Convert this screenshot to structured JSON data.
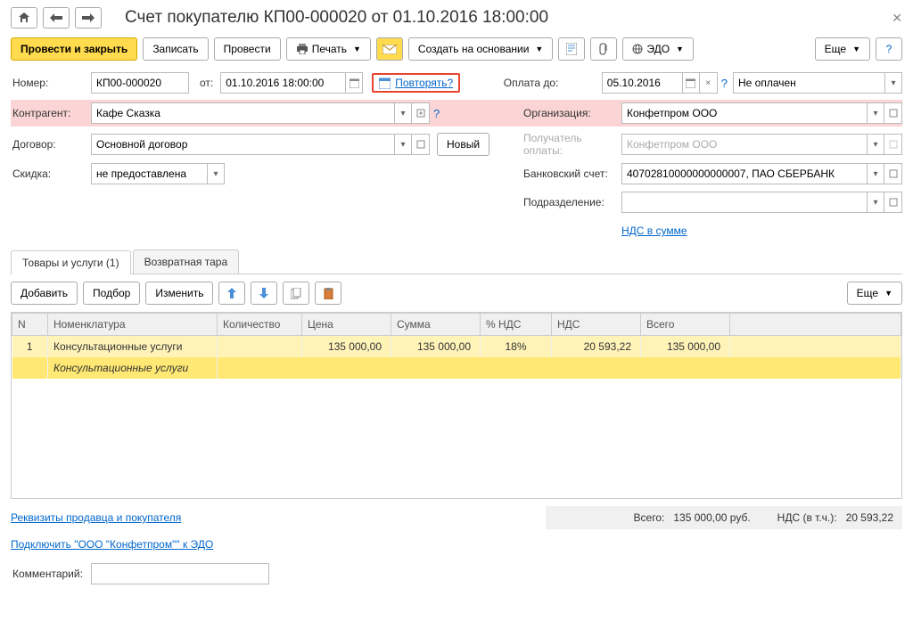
{
  "header": {
    "title": "Счет покупателю КП00-000020 от 01.10.2016 18:00:00"
  },
  "toolbar": {
    "post_close": "Провести и закрыть",
    "write": "Записать",
    "post": "Провести",
    "print": "Печать",
    "create_based": "Создать на основании",
    "edo": "ЭДО",
    "more": "Еще"
  },
  "form": {
    "number_lbl": "Номер:",
    "number": "КП00-000020",
    "from_lbl": "от:",
    "date": "01.10.2016 18:00:00",
    "repeat_link": "Повторять?",
    "payment_due_lbl": "Оплата до:",
    "payment_due": "05.10.2016",
    "status": "Не оплачен",
    "counterparty_lbl": "Контрагент:",
    "counterparty": "Кафе Сказка",
    "organization_lbl": "Организация:",
    "organization": "Конфетпром ООО",
    "contract_lbl": "Договор:",
    "contract": "Основной договор",
    "new_btn": "Новый",
    "payee_lbl": "Получатель оплаты:",
    "payee": "Конфетпром ООО",
    "discount_lbl": "Скидка:",
    "discount": "не предоставлена",
    "bank_account_lbl": "Банковский счет:",
    "bank_account": "40702810000000000007, ПАО СБЕРБАНК",
    "department_lbl": "Подразделение:",
    "vat_mode_link": "НДС в сумме"
  },
  "tabs": {
    "goods": "Товары и услуги (1)",
    "returnable": "Возвратная тара"
  },
  "tab_toolbar": {
    "add": "Добавить",
    "pick": "Подбор",
    "change": "Изменить",
    "more": "Еще"
  },
  "table": {
    "headers": {
      "n": "N",
      "item": "Номенклатура",
      "qty": "Количество",
      "price": "Цена",
      "sum": "Сумма",
      "vat_pct": "% НДС",
      "vat": "НДС",
      "total": "Всего"
    },
    "rows": [
      {
        "n": "1",
        "item": "Консультационные услуги",
        "qty": "",
        "price": "135 000,00",
        "sum": "135 000,00",
        "vat_pct": "18%",
        "vat": "20 593,22",
        "total": "135 000,00",
        "sub": "Консультационные услуги"
      }
    ]
  },
  "totals": {
    "total_lbl": "Всего:",
    "total": "135 000,00",
    "currency": "руб.",
    "vat_lbl": "НДС (в т.ч.):",
    "vat": "20 593,22"
  },
  "footer": {
    "requisites_link": "Реквизиты продавца и покупателя",
    "edo_link": "Подключить \"ООО \"Конфетпром\"\" к ЭДО",
    "comment_lbl": "Комментарий:"
  }
}
